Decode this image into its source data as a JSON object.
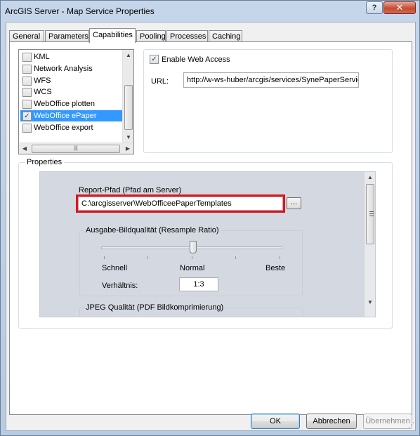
{
  "window": {
    "title": "ArcGIS Server - Map Service Properties"
  },
  "titlebar": {
    "help_glyph": "?",
    "close_glyph": "✕"
  },
  "tabs": [
    {
      "label": "General"
    },
    {
      "label": "Parameters"
    },
    {
      "label": "Capabilities"
    },
    {
      "label": "Pooling"
    },
    {
      "label": "Processes"
    },
    {
      "label": "Caching"
    }
  ],
  "capabilities_list": {
    "items": [
      {
        "label": "KML",
        "checked": false
      },
      {
        "label": "Network Analysis",
        "checked": false
      },
      {
        "label": "WFS",
        "checked": false
      },
      {
        "label": "WCS",
        "checked": false
      },
      {
        "label": "WebOffice plotten",
        "checked": false
      },
      {
        "label": "WebOffice ePaper",
        "checked": true,
        "selected": true
      },
      {
        "label": "WebOffice export",
        "checked": false
      }
    ]
  },
  "web_access": {
    "enable_label": "Enable Web Access",
    "enabled": true,
    "url_label": "URL:",
    "url_value": "http://w-ws-huber/arcgis/services/SynePaperService"
  },
  "properties": {
    "group_label": "Properties",
    "report_path_label": "Report-Pfad (Pfad am Server)",
    "report_path_value": "C:\\arcgisserver\\WebOfficeePaperTemplates",
    "browse_label": "...",
    "quality_group_label": "Ausgabe-Bildqualität (Resample Ratio)",
    "quality_levels": [
      "Schnell",
      "Normal",
      "Beste"
    ],
    "quality_slider_position": 0.5,
    "ratio_label": "Verhältnis:",
    "ratio_value": "1:3",
    "jpeg_group_label": "JPEG Qualität (PDF Bildkomprimierung)"
  },
  "buttons": {
    "ok": "OK",
    "cancel": "Abbrechen",
    "apply": "Übernehmen"
  },
  "colors": {
    "selection": "#3399ff",
    "highlight_frame": "#e0141c",
    "close_button": "#c54a30"
  }
}
